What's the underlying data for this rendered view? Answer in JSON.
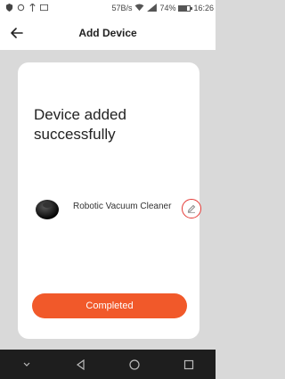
{
  "status_bar": {
    "network_speed": "57B/s",
    "battery_percent": "74%",
    "time": "16:26",
    "battery_level": 0.74
  },
  "header": {
    "title": "Add Device",
    "back_icon": "arrow-left-icon"
  },
  "card": {
    "headline": "Device added successfully",
    "device_name": "Robotic Vacuum Cleaner",
    "edit_icon": "pencil-icon",
    "completed_label": "Completed"
  },
  "nav": {
    "items": [
      "chevron-down-icon",
      "back-triangle-icon",
      "home-circle-icon",
      "recents-square-icon"
    ]
  },
  "colors": {
    "accent": "#f1592a",
    "edit_ring": "#e53935",
    "background": "#d9d9d9"
  }
}
